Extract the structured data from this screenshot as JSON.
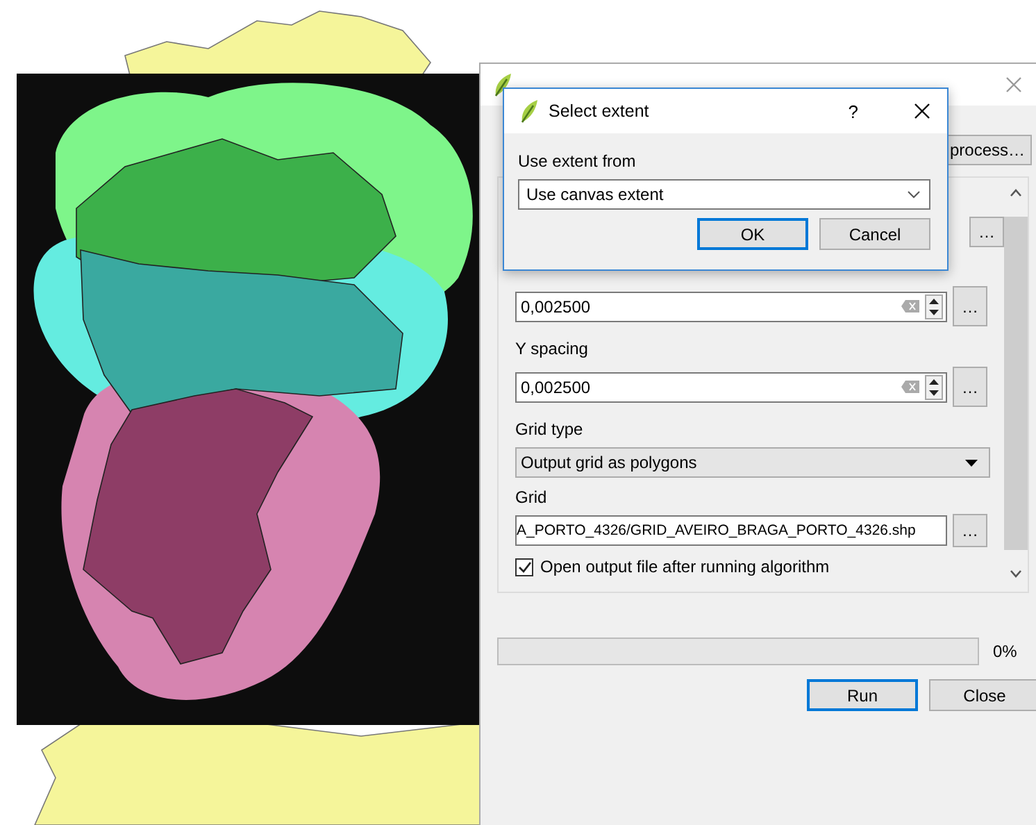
{
  "vector_grid_dialog": {
    "top_button": "process…",
    "extent_button": "…",
    "x_spacing": {
      "value": "0,002500",
      "button": "…"
    },
    "y_spacing": {
      "label": "Y spacing",
      "value": "0,002500",
      "button": "…"
    },
    "grid_type": {
      "label": "Grid type",
      "value": "Output grid as polygons"
    },
    "grid": {
      "label": "Grid",
      "value": "A_PORTO_4326/GRID_AVEIRO_BRAGA_PORTO_4326.shp",
      "button": "…"
    },
    "open_output": {
      "label": "Open output file after running algorithm",
      "checked": true
    },
    "progress": {
      "level": 0,
      "reading": "0%"
    },
    "buttons": [
      {
        "label": "Run",
        "default": true
      },
      {
        "label": "Close",
        "default": false
      }
    ]
  },
  "select_extent_dialog": {
    "title": "Select extent",
    "help": "?",
    "label": "Use extent from",
    "value": "Use canvas extent",
    "buttons": [
      {
        "label": "OK",
        "default": true
      },
      {
        "label": "Cancel",
        "default": false
      }
    ]
  }
}
